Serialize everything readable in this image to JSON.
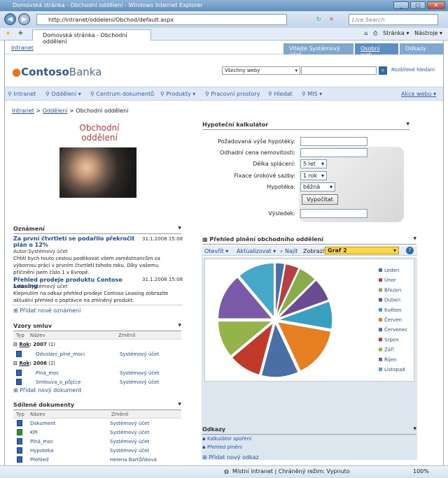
{
  "window": {
    "title": "Domovská stránka - Obchodní oddělení - Windows Internet Explorer"
  },
  "address": {
    "url": "http://intranet/oddeleni/Obchod/default.aspx",
    "search_placeholder": "Live Search"
  },
  "tab": {
    "label": "Domovská stránka - Obchodní oddělení"
  },
  "tools": {
    "page": "Stránka",
    "tools": "Nástroje"
  },
  "site": {
    "intranet": "Intranet",
    "welcome": "Vítejte Systémový účet",
    "mysite": "Osobní web",
    "other": "Odkazy"
  },
  "logo": {
    "part1": "Contoso",
    "part2": "Banka"
  },
  "search": {
    "scope": "Všechny weby",
    "advanced": "Rozšířené hledání"
  },
  "nav": [
    "Intranet",
    "Oddělení",
    "Centrum dokumentů",
    "Produkty",
    "Pracovní prostory",
    "Hledat",
    "MIS"
  ],
  "nav_action": "Akce webu",
  "breadcrumb": {
    "a": "Intranet",
    "b": "Oddělení",
    "c": "Obchodní oddělení"
  },
  "dept": {
    "line1": "Obchodní",
    "line2": "oddělení"
  },
  "announcements": {
    "title": "Oznámení",
    "items": [
      {
        "title": "Za první čtvrtletí se podařilo překročit plán o 12%",
        "date": "31.1.2008 15:08",
        "author": "Autor:Systémový účet",
        "body": "Chtěl bych touto cestou poděkovat všem zaměstnancům za výbornou práci v prvním čtvrtletí tohoto roku. Díky vašemu přičinění jsem číslo 1 v Evropě."
      },
      {
        "title": "Přehled prodeje produktu Contoso Leasing",
        "date": "31.1.2008 15:08",
        "author": "Autor:Systémový účet",
        "body": "Klepnutím na odkaz přehled prodeje Contoso Leasing zobrazíte aktuální přehled o poptávce na zmíněný produkt."
      }
    ],
    "add": "Přidat nové oznámení"
  },
  "contracts": {
    "title": "Vzory smluv",
    "col_type": "Typ",
    "col_name": "Název",
    "col_mod": "Změnil",
    "groups": [
      {
        "label": "Rok",
        "value": ": 2007",
        "count": "(1)",
        "rows": [
          {
            "name": "Odvolání_plné_moci",
            "mod": "Systémový účet"
          }
        ]
      },
      {
        "label": "Rok",
        "value": ": 2008",
        "count": "(2)",
        "rows": [
          {
            "name": "Plná_moc",
            "mod": "Systémový účet"
          },
          {
            "name": "Smlouva_o_půjčce",
            "mod": "Systémový účet"
          }
        ]
      }
    ],
    "add": "Přidat nový dokument"
  },
  "shared": {
    "title": "Sdílené dokumenty",
    "col_type": "Typ",
    "col_name": "Název",
    "col_mod": "Změnil",
    "rows": [
      {
        "name": "Dokument",
        "mod": "Systémový účet"
      },
      {
        "name": "KPI",
        "mod": "Systémový účet"
      },
      {
        "name": "Plná_moc",
        "mod": "Systémový účet"
      },
      {
        "name": "Hypoteka",
        "mod": "Systémový účet"
      },
      {
        "name": "Přehled",
        "mod": "Helena Bartůňková"
      }
    ]
  },
  "calc": {
    "title": "Hypoteční kalkulátor",
    "l1": "Požadovaná výše hypotéky:",
    "l2": "Odhadní cena nemovitosti:",
    "l3": "Délka splácení:",
    "v3": "5 let",
    "l4": "Fixace úrokové sazby:",
    "v4": "1 rok",
    "l5": "Hypotéka:",
    "v5": "běžná",
    "button": "Vypočítat",
    "l6": "Výsledek:"
  },
  "chart": {
    "title": "Přehled plnění obchodního oddělení",
    "open": "Otevřít",
    "refresh": "Aktualizovat",
    "find": "Najít",
    "show": "Zobrazit:",
    "graph": "Graf 2"
  },
  "chart_data": {
    "type": "pie",
    "series": [
      {
        "values": [
          2,
          3,
          4,
          5,
          6,
          11,
          8,
          7,
          8,
          10,
          8
        ]
      }
    ],
    "categories": [
      "Leden",
      "Únor",
      "Březen",
      "Duben",
      "Květen",
      "Červen",
      "Červenec",
      "Srpen",
      "Září",
      "Říjen",
      "Listopad"
    ],
    "colors": [
      "#4a6fa5",
      "#b34141",
      "#8aab4a",
      "#6a4c93",
      "#3aa0c0",
      "#e67e22",
      "#4a6fa5",
      "#c0392b",
      "#94b44a",
      "#7a5aa6",
      "#45a8c9"
    ]
  },
  "links": {
    "title": "Odkazy",
    "items": [
      "Kalkulátor spoření",
      "Přehled plnění"
    ],
    "add": "Přidat nový odkaz"
  },
  "status": {
    "zone": "Místní intranet | Chráněný režim: Vypnuto",
    "zoom": "100%"
  }
}
